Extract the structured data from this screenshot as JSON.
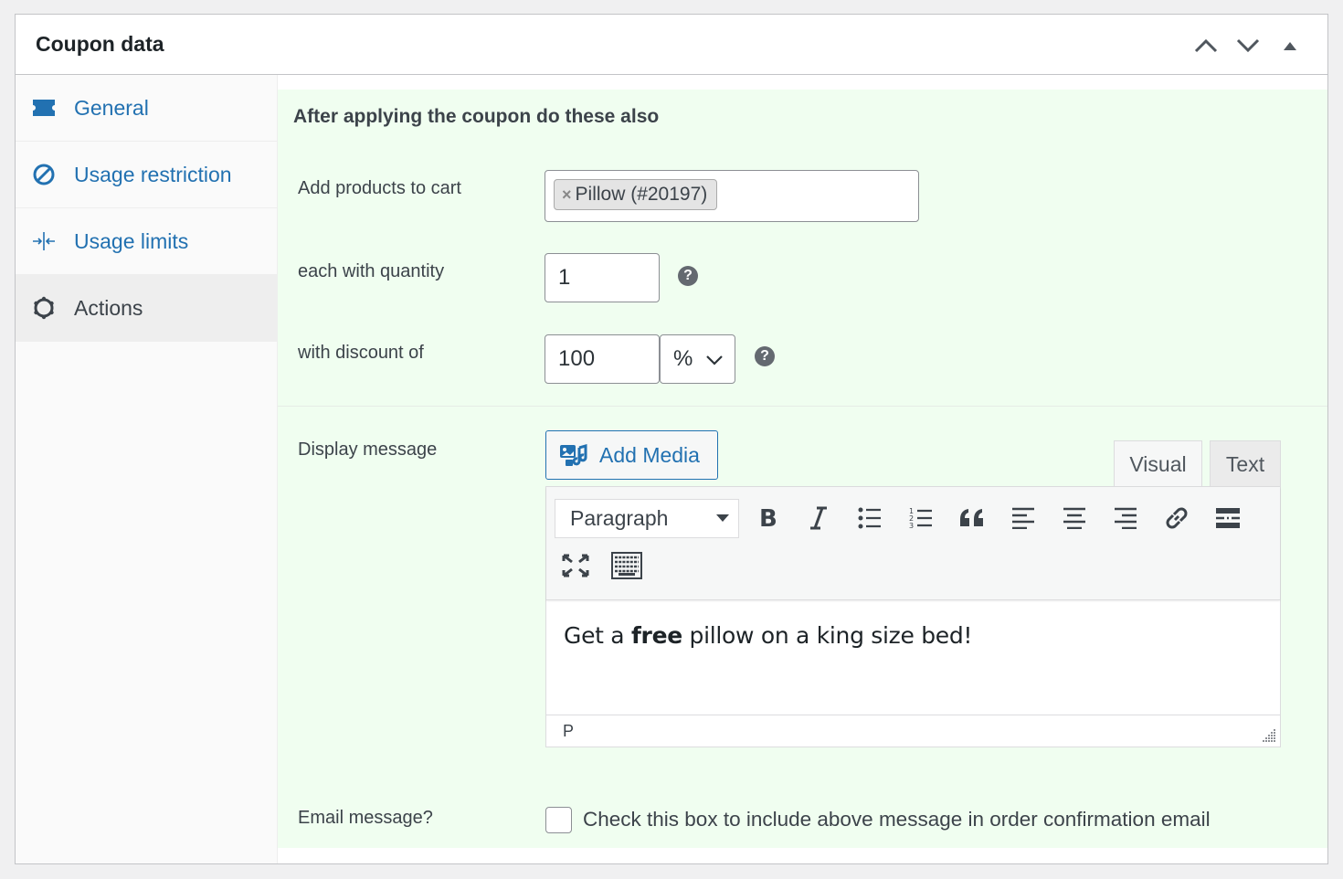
{
  "panel": {
    "title": "Coupon data",
    "header_actions": [
      "move-up",
      "move-down",
      "toggle-panel"
    ]
  },
  "tabs": [
    {
      "label": "General",
      "icon": "ticket-icon",
      "active": false
    },
    {
      "label": "Usage restriction",
      "icon": "block-icon",
      "active": false
    },
    {
      "label": "Usage limits",
      "icon": "limits-icon",
      "active": false
    },
    {
      "label": "Actions",
      "icon": "gear-icon",
      "active": true
    }
  ],
  "actions": {
    "section_title": "After applying the coupon do these also",
    "add_products": {
      "label": "Add products to cart",
      "selected": [
        {
          "remove": "×",
          "text": "Pillow (#20197)"
        }
      ]
    },
    "quantity": {
      "label": "each with quantity",
      "value": "1",
      "help": "?"
    },
    "discount": {
      "label": "with discount of",
      "value": "100",
      "type": "%",
      "help": "?"
    },
    "display_message": {
      "label": "Display message",
      "add_media": "Add Media",
      "tabs": {
        "visual": "Visual",
        "text": "Text"
      },
      "format": "Paragraph",
      "toolbar": [
        "bold",
        "italic",
        "bulleted-list",
        "numbered-list",
        "blockquote",
        "align-left",
        "align-center",
        "align-right",
        "link",
        "read-more",
        "fullscreen",
        "toolbar-toggle"
      ],
      "content": {
        "before": "Get a ",
        "bold": "free",
        "after": " pillow on a king size bed!"
      },
      "path": "P"
    },
    "email": {
      "label": "Email message?",
      "checked": false,
      "checkbox_label": "Check this box to include above message in order confirmation email"
    }
  }
}
